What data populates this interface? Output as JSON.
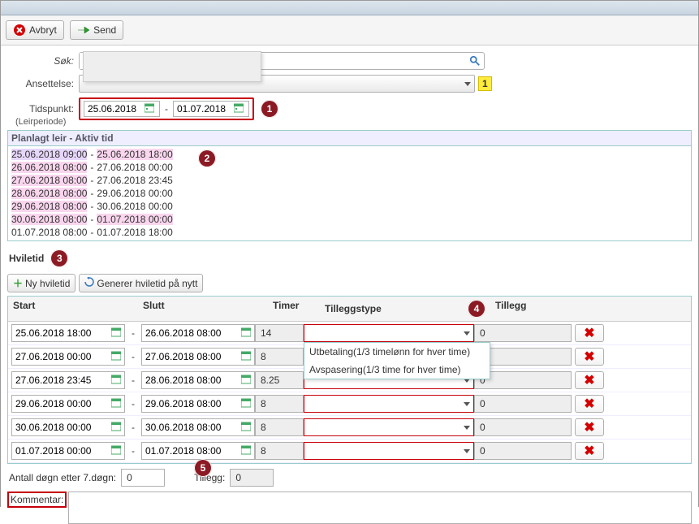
{
  "toolbar": {
    "cancel_label": "Avbryt",
    "send_label": "Send"
  },
  "search": {
    "label": "Søk:",
    "value": "",
    "placeholder": ""
  },
  "ansettelse": {
    "label": "Ansettelse:",
    "badge": "1"
  },
  "tidspunkt": {
    "label": "Tidspunkt:",
    "from": "25.06.2018",
    "to": "01.07.2018",
    "sublabel": "(Leirperiode)"
  },
  "annotations": {
    "a1": "1",
    "a2": "2",
    "a3": "3",
    "a4": "4",
    "a5": "5"
  },
  "aktiv": {
    "title": "Planlagt leir - Aktiv tid",
    "rows": [
      {
        "from": "25.06.2018 09:00",
        "to": "25.06.2018 18:00",
        "from_cls": "lav",
        "to_cls": "pink"
      },
      {
        "from": "26.06.2018 08:00",
        "to": "27.06.2018 00:00",
        "from_cls": "pink",
        "to_cls": ""
      },
      {
        "from": "27.06.2018 08:00",
        "to": "27.06.2018 23:45",
        "from_cls": "pink",
        "to_cls": ""
      },
      {
        "from": "28.06.2018 08:00",
        "to": "29.06.2018 00:00",
        "from_cls": "pink",
        "to_cls": ""
      },
      {
        "from": "29.06.2018 08:00",
        "to": "30.06.2018 00:00",
        "from_cls": "pink",
        "to_cls": ""
      },
      {
        "from": "30.06.2018 08:00",
        "to": "01.07.2018 00:00",
        "from_cls": "pink",
        "to_cls": "pink"
      },
      {
        "from": "01.07.2018 08:00",
        "to": "01.07.2018 18:00",
        "from_cls": "",
        "to_cls": ""
      }
    ]
  },
  "hviletid": {
    "title": "Hviletid",
    "new_btn": "Ny hviletid",
    "gen_btn": "Generer hviletid på nytt",
    "headers": {
      "start": "Start",
      "slutt": "Slutt",
      "timer": "Timer",
      "type": "Tilleggstype",
      "tillegg": "Tillegg"
    },
    "combo_options": [
      "Utbetaling(1/3 timelønn for hver time)",
      "Avspasering(1/3 time for hver time)"
    ],
    "rows": [
      {
        "start": "25.06.2018 18:00",
        "slutt": "26.06.2018 08:00",
        "timer": "14",
        "tillegg": "0",
        "open": true
      },
      {
        "start": "27.06.2018 00:00",
        "slutt": "27.06.2018 08:00",
        "timer": "8",
        "tillegg": "0",
        "open": false
      },
      {
        "start": "27.06.2018 23:45",
        "slutt": "28.06.2018 08:00",
        "timer": "8.25",
        "tillegg": "0",
        "open": false
      },
      {
        "start": "29.06.2018 00:00",
        "slutt": "29.06.2018 08:00",
        "timer": "8",
        "tillegg": "0",
        "open": false
      },
      {
        "start": "30.06.2018 00:00",
        "slutt": "30.06.2018 08:00",
        "timer": "8",
        "tillegg": "0",
        "open": false
      },
      {
        "start": "01.07.2018 00:00",
        "slutt": "01.07.2018 08:00",
        "timer": "8",
        "tillegg": "0",
        "open": false
      }
    ]
  },
  "bottom": {
    "dogn_label": "Antall døgn etter 7.døgn:",
    "dogn_value": "0",
    "tillegg_label": "Tillegg:",
    "tillegg_value": "0"
  },
  "kommentar": {
    "label": "Kommentar:"
  }
}
